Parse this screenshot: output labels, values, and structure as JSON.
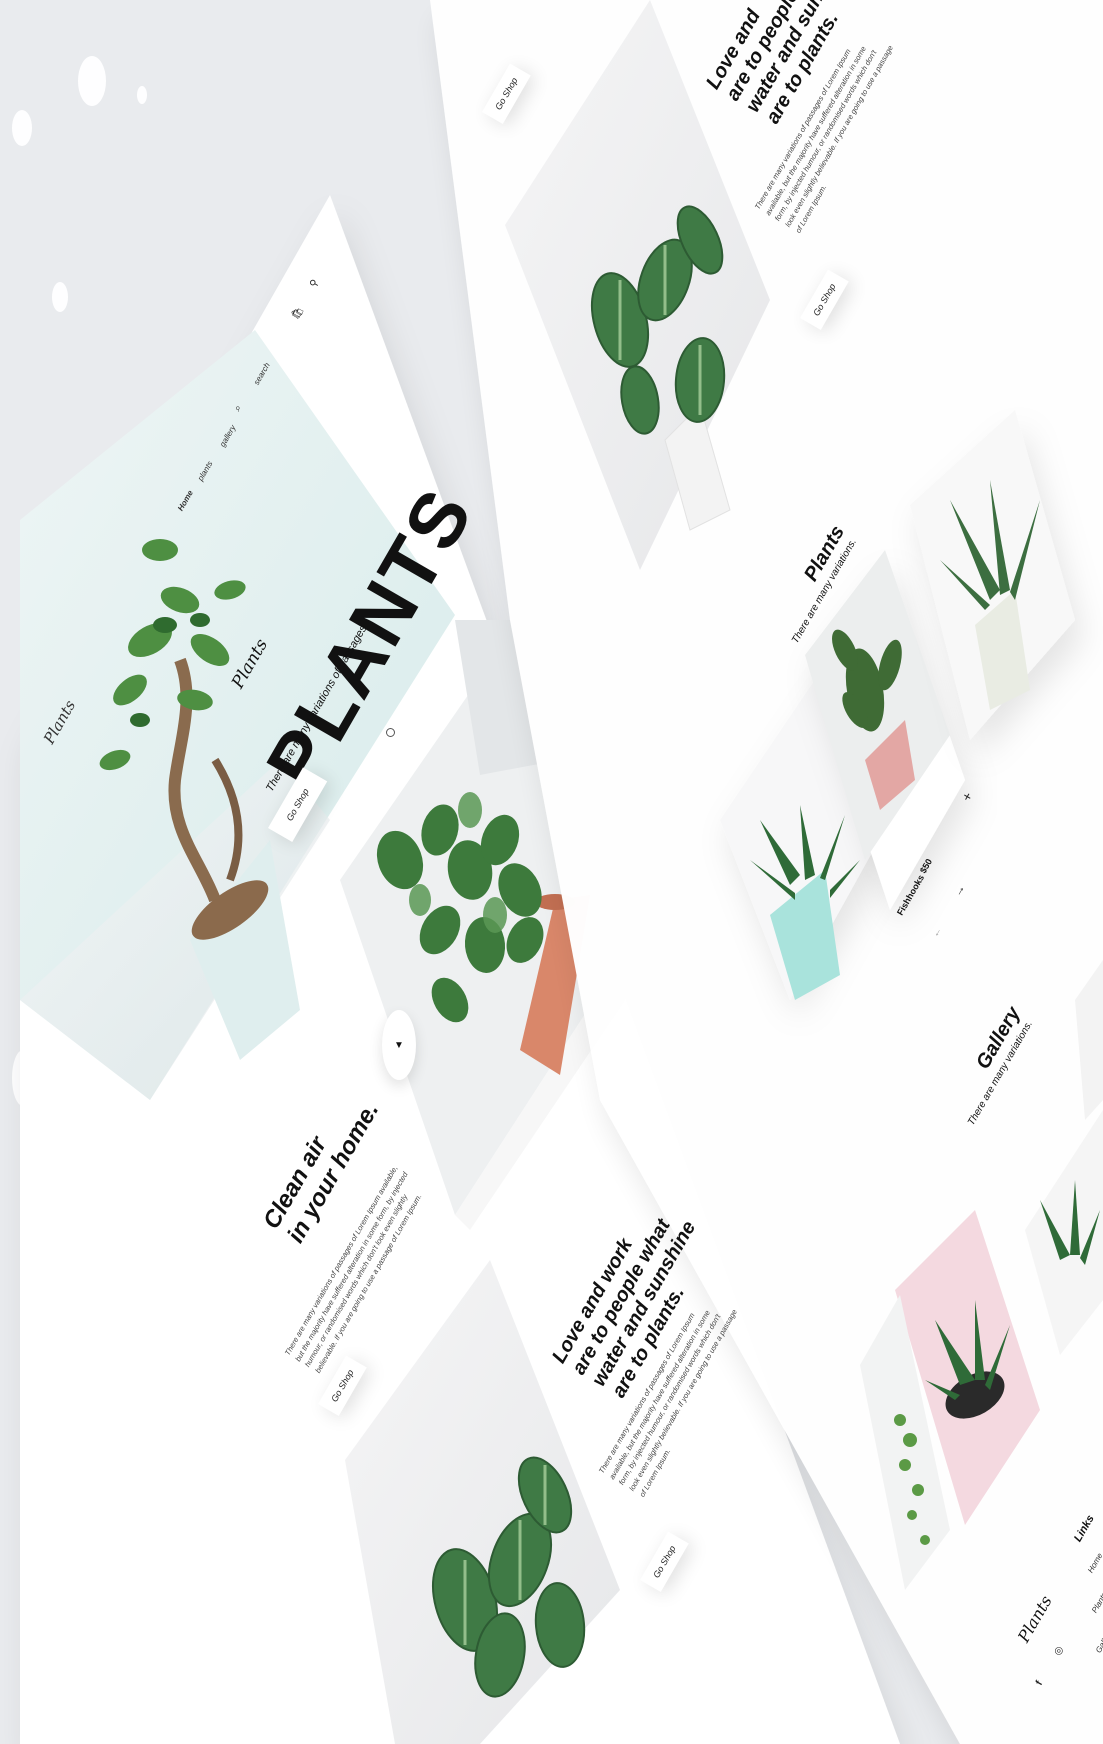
{
  "nav": {
    "brand": "Plants",
    "items": [
      "Home",
      "plants",
      "gallery"
    ],
    "search_label": "search"
  },
  "hero": {
    "script_label": "Plants",
    "title": "PLANTS",
    "subtitle": "There are many variations of passages.",
    "button": "Go Shop"
  },
  "section_clean": {
    "heading_line1": "Clean air",
    "heading_line2": "in your home.",
    "body": "There are many variations of passages of Lorem Ipsum available, but the majority have suffered alteration in some form, by injected humour, or randomised words which don't look even slightly believable. If you are going to use a passage of Lorem Ipsum.",
    "button": "Go Shop"
  },
  "section_love": {
    "heading_lines": [
      "Love and work",
      "are to people what",
      "water and sunshine",
      "are to plants."
    ],
    "body": "There are many variations of passages of Lorem Ipsum available, but the majority have suffered alteration in some form, by injected humour, or randomised words which don't look even slightly believable. If you are going to use a passage of Lorem Ipsum.",
    "button": "Go Shop"
  },
  "top_fragment": {
    "heading_lines": [
      "Love and",
      "are to people",
      "water and sunsh",
      "are to plants."
    ],
    "body": "There are many variations of passages of Lorem Ipsum available, but the majority have suffered alteration in some form, by injected humour, or randomised words which don't look even slightly believable. If you are going to use a passage of Lorem Ipsum.",
    "button": "Go Shop",
    "button_top": "Go Shop"
  },
  "products": {
    "title": "Plants",
    "subtitle": "There are many variations.",
    "featured_name": "Fishhooks",
    "featured_price": "$50",
    "add_symbol": "+",
    "next_symbol": "→",
    "prev_symbol": "←"
  },
  "gallery": {
    "title": "Gallery",
    "subtitle": "There are many variations."
  },
  "footer": {
    "brand": "Plants",
    "links_title": "Links",
    "links": [
      "Home",
      "Plants",
      "Gallery"
    ],
    "social": [
      "f",
      "◎"
    ]
  },
  "colors": {
    "background": "#e9ebee",
    "panel": "#ffffff",
    "hero_tint": "#e2eeee",
    "mint_pot": "#a9e3dc",
    "pink_bg": "#f4d9e0",
    "terracotta": "#d9876a",
    "leaf_dark": "#2f5f2f",
    "leaf_mid": "#4f8a4a"
  }
}
